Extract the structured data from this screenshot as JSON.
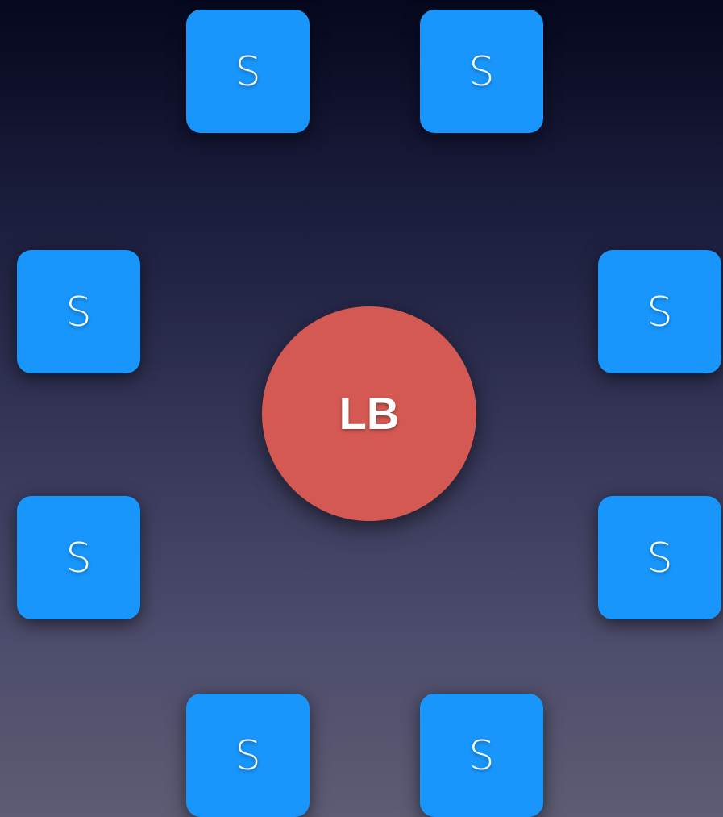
{
  "load_balancer": {
    "label": "LB",
    "color": "#d55953"
  },
  "server_color": "#1896fc",
  "servers": [
    {
      "label": "S"
    },
    {
      "label": "S"
    },
    {
      "label": "S"
    },
    {
      "label": "S"
    },
    {
      "label": "S"
    },
    {
      "label": "S"
    },
    {
      "label": "S"
    },
    {
      "label": "S"
    }
  ]
}
